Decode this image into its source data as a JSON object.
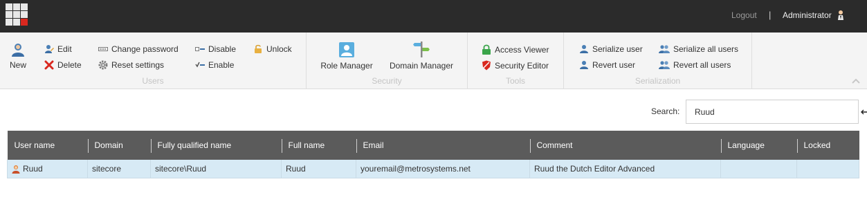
{
  "header": {
    "logout_label": "Logout",
    "separator": "|",
    "user_label": "Administrator"
  },
  "ribbon": {
    "users": {
      "title": "Users",
      "new_label": "New",
      "edit_label": "Edit",
      "delete_label": "Delete",
      "change_password_label": "Change password",
      "reset_settings_label": "Reset settings",
      "disable_label": "Disable",
      "enable_label": "Enable",
      "unlock_label": "Unlock"
    },
    "security": {
      "title": "Security",
      "role_manager_label": "Role Manager",
      "domain_manager_label": "Domain Manager"
    },
    "tools": {
      "title": "Tools",
      "access_viewer_label": "Access Viewer",
      "security_editor_label": "Security Editor"
    },
    "serialization": {
      "title": "Serialization",
      "serialize_user_label": "Serialize user",
      "revert_user_label": "Revert user",
      "serialize_all_label": "Serialize all users",
      "revert_all_label": "Revert all users"
    }
  },
  "search": {
    "label": "Search:",
    "value": "Ruud"
  },
  "table": {
    "headers": [
      "User name",
      "Domain",
      "Fully qualified name",
      "Full name",
      "Email",
      "Comment",
      "Language",
      "Locked"
    ],
    "rows": [
      [
        "Ruud",
        "sitecore",
        "sitecore\\Ruud",
        "Ruud",
        "youremail@metrosystems.net",
        "Ruud the Dutch Editor Advanced",
        "",
        ""
      ]
    ]
  },
  "colors": {
    "topbar": "#2b2b2b",
    "ribbon": "#f4f4f4",
    "table_header": "#5b5b5b",
    "selected_row": "#d7eaf5",
    "accent_red": "#d9281f"
  }
}
